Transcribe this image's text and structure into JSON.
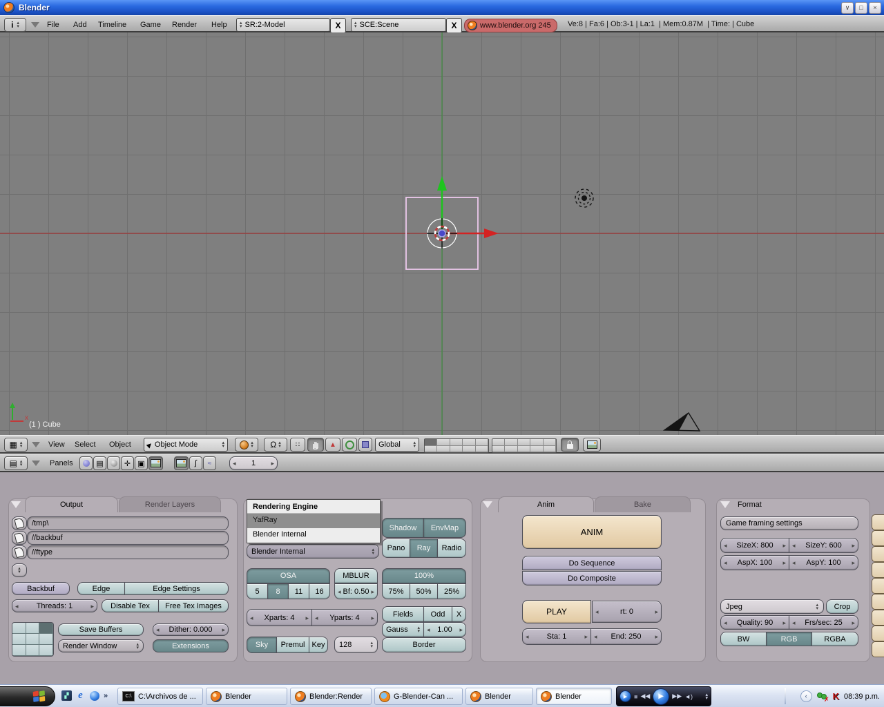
{
  "window": {
    "title": "Blender"
  },
  "header": {
    "menus": [
      "File",
      "Add",
      "Timeline",
      "Game",
      "Render",
      "Help"
    ],
    "screen_selector": "SR:2-Model",
    "scene_selector": "SCE:Scene",
    "close_x": "X",
    "version_badge": "www.blender.org 245",
    "stats": "Ve:8 | Fa:6 | Ob:3-1 | La:1  | Mem:0.87M  | Time: | Cube"
  },
  "viewport": {
    "object_label": "(1 ) Cube",
    "axis_x_label": "x"
  },
  "vp_header": {
    "menus": [
      "View",
      "Select",
      "Object"
    ],
    "mode_selector": "Object Mode",
    "orientation_selector": "Global"
  },
  "buttons_header": {
    "panels_label": "Panels",
    "frame_value": "1"
  },
  "output": {
    "tab_output": "Output",
    "tab_render_layers": "Render Layers",
    "paths": [
      "/tmp\\",
      "//backbuf",
      "//ftype"
    ],
    "backbuf": "Backbuf",
    "edge": "Edge",
    "edge_settings": "Edge Settings",
    "threads": "Threads: 1",
    "disable_tex": "Disable Tex",
    "free_tex": "Free Tex Images",
    "save_buffers": "Save Buffers",
    "render_window": "Render Window",
    "dither": "Dither: 0.000",
    "extensions": "Extensions"
  },
  "engine_menu": {
    "title": "Rendering Engine",
    "yafray": "YafRay",
    "internal": "Blender Internal",
    "selected": "Blender Internal"
  },
  "render": {
    "shadow": "Shadow",
    "envmap": "EnvMap",
    "pano": "Pano",
    "ray": "Ray",
    "radio": "Radio",
    "osa": "OSA",
    "osa5": "5",
    "osa8": "8",
    "osa11": "11",
    "osa16": "16",
    "mblur": "MBLUR",
    "bf": "Bf: 0.50",
    "p100": "100%",
    "p75": "75%",
    "p50": "50%",
    "p25": "25%",
    "xparts": "Xparts: 4",
    "yparts": "Yparts: 4",
    "fields": "Fields",
    "odd": "Odd",
    "x": "X",
    "gauss": "Gauss",
    "gauss_val": "1.00",
    "sky": "Sky",
    "premul": "Premul",
    "key": "Key",
    "bits": "128",
    "border": "Border"
  },
  "anim": {
    "tab_anim": "Anim",
    "tab_bake": "Bake",
    "anim_button": "ANIM",
    "do_sequence": "Do Sequence",
    "do_composite": "Do Composite",
    "play": "PLAY",
    "rt": "rt: 0",
    "sta": "Sta: 1",
    "end": "End: 250"
  },
  "format": {
    "title": "Format",
    "game_framing": "Game framing settings",
    "sizex": "SizeX: 800",
    "sizey": "SizeY: 600",
    "aspx": "AspX: 100",
    "aspy": "AspY: 100",
    "filetype": "Jpeg",
    "crop": "Crop",
    "quality": "Quality: 90",
    "fps": "Frs/sec: 25",
    "bw": "BW",
    "rgb": "RGB",
    "rgba": "RGBA"
  },
  "taskbar": {
    "overflow": "»",
    "items": [
      "C:\\Archivos de ...",
      "Blender",
      "Blender:Render",
      "G-Blender-Can ...",
      "Blender",
      "Blender"
    ],
    "clock": "08:39 p.m."
  },
  "colors": {
    "titlebar_blue": "#2a6ae0",
    "viewport_grey": "#7f7f7f",
    "panel_mauve": "#b5aeb5",
    "button_teal": "#c0d4d4",
    "button_teal_pressed": "#6f8f91",
    "button_tan": "#e5cfae",
    "badge_red": "#ca6a6a",
    "axis_red": "#b03030",
    "axis_green": "#3f8f3f"
  }
}
